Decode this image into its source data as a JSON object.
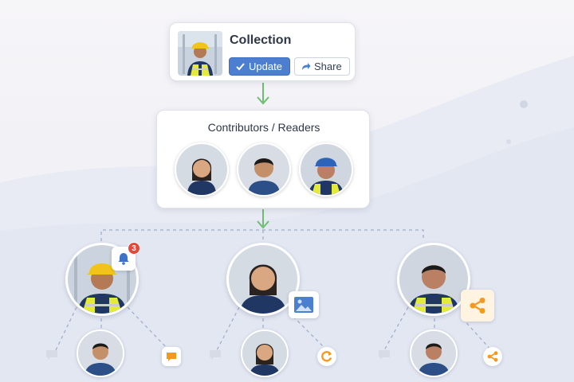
{
  "collection": {
    "title": "Collection",
    "update_label": "Update",
    "share_label": "Share",
    "icons": [
      "check-icon",
      "share-arrow-icon"
    ]
  },
  "contributors": {
    "title": "Contributors / Readers",
    "avatars": [
      "woman-avatar",
      "man-avatar",
      "hardhat-worker-avatar"
    ]
  },
  "branches": [
    {
      "name": "worker-hardhat",
      "icon": "bell-icon",
      "badge": "3",
      "children": [
        "man-child-avatar"
      ],
      "leaf_icons": [
        "comment-icon-faded",
        "comment-icon-orange"
      ]
    },
    {
      "name": "worker-woman",
      "icon": "image-icon",
      "children": [
        "woman-child-avatar"
      ],
      "leaf_icons": [
        "comment-icon-faded",
        "refresh-icon-orange"
      ]
    },
    {
      "name": "worker-vest",
      "icon": "share-nodes-icon",
      "children": [
        "man-child-avatar"
      ],
      "leaf_icons": [
        "comment-icon-faded",
        "share-nodes-icon-orange"
      ]
    }
  ],
  "colors": {
    "accent_blue": "#4c7fcf",
    "connector_green": "#6fbd73",
    "dashed_line": "#9fb0cc",
    "badge_red": "#e24a3b",
    "orange": "#f39a1e"
  }
}
